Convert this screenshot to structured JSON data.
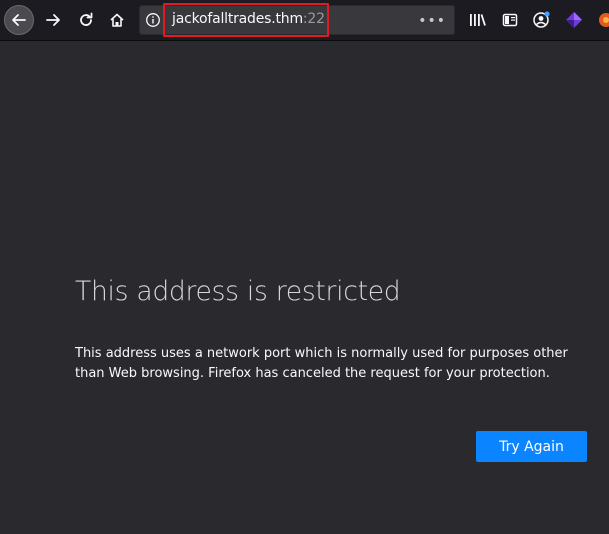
{
  "browser": {
    "url_host": "jackofalltrades.thm",
    "url_port": ":22",
    "page_actions_glyph": "•••"
  },
  "error": {
    "title": "This address is restricted",
    "description": "This address uses a network port which is normally used for purposes other than Web browsing. Firefox has canceled the request for your protection.",
    "try_again_label": "Try Again"
  },
  "colors": {
    "toolbar_bg": "#1c1b22",
    "page_bg": "#2a2a2e",
    "accent_button": "#0a84ff",
    "url_highlight_border": "#e01b24"
  },
  "icons": {
    "back": "back-arrow-icon",
    "forward": "forward-arrow-icon",
    "reload": "reload-icon",
    "home": "home-icon",
    "info": "info-icon",
    "library": "library-icon",
    "sidebar": "sidebar-icon",
    "account": "account-icon",
    "extension": "extension-icon"
  }
}
